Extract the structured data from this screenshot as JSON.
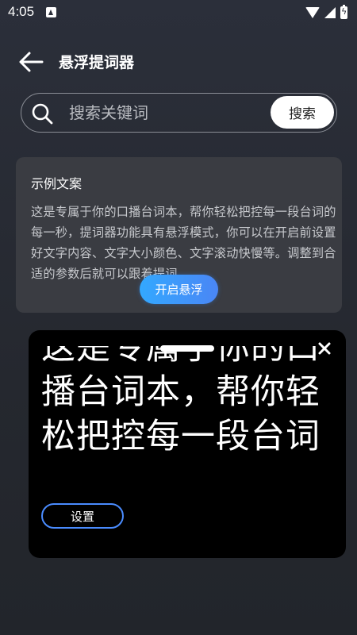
{
  "status": {
    "time": "4:05"
  },
  "header": {
    "title": "悬浮提词器"
  },
  "search": {
    "placeholder": "搜索关键词",
    "button_label": "搜索"
  },
  "example": {
    "title": "示例文案",
    "body": "这是专属于你的口播台词本，帮你轻松把控每一段台词的每一秒，提词器功能具有悬浮模式，你可以在开启前设置好文字内容、文字大小颜色、文字滚动快慢等。调整到合适的参数后就可以跟着提词..."
  },
  "start_float_label": "开启悬浮",
  "float_window": {
    "text": "这是专属于你的口播台词本，帮你轻松把控每一段台词",
    "settings_label": "设置"
  },
  "colors": {
    "accent": "#4a8cff",
    "background": "#2b2f3a",
    "card": "#3a3c42",
    "float_bg": "#000000"
  }
}
